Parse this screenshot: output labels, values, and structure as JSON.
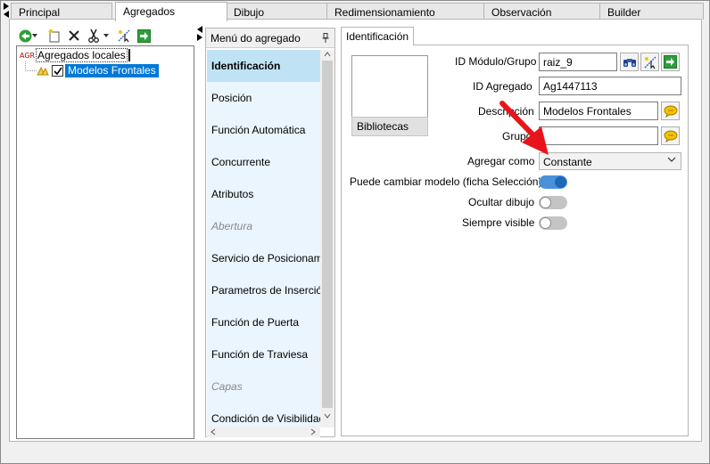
{
  "tabs": [
    {
      "label": "Principal",
      "active": false
    },
    {
      "label": "Agregados",
      "active": true
    },
    {
      "label": "Dibujo",
      "active": false
    },
    {
      "label": "Redimensionamiento",
      "active": false
    },
    {
      "label": "Observación",
      "active": false
    },
    {
      "label": "Builder",
      "active": false
    }
  ],
  "tree": {
    "root_badge": "AGR",
    "root_label": "Agregados locales",
    "child_label": "Modelos Frontales",
    "child_checked": true
  },
  "menu": {
    "header": "Menú do agregado",
    "items": [
      {
        "label": "Identificación",
        "state": "selected"
      },
      {
        "label": "Posición",
        "state": "normal"
      },
      {
        "label": "Función Automática",
        "state": "normal"
      },
      {
        "label": "Concurrente",
        "state": "normal"
      },
      {
        "label": "Atributos",
        "state": "normal"
      },
      {
        "label": "Abertura",
        "state": "disabled"
      },
      {
        "label": "Servicio de Posicionamiento",
        "state": "normal"
      },
      {
        "label": "Parametros de Inserción",
        "state": "normal"
      },
      {
        "label": "Función de Puerta",
        "state": "normal"
      },
      {
        "label": "Función de Traviesa",
        "state": "normal"
      },
      {
        "label": "Capas",
        "state": "disabled"
      },
      {
        "label": "Condición de Visibilidad",
        "state": "normal"
      }
    ]
  },
  "identificacion": {
    "tab_label": "Identificación",
    "bibliotecas_label": "Bibliotecas",
    "id_modulo_label": "ID Módulo/Grupo",
    "id_modulo_value": "raiz_9",
    "id_agregado_label": "ID Agregado",
    "id_agregado_value": "Ag1447113",
    "descripcion_label": "Descripción",
    "descripcion_value": "Modelos Frontales",
    "grupo_label": "Grupo",
    "grupo_value": "",
    "agregar_como_label": "Agregar como",
    "agregar_como_value": "Constante",
    "puede_cambiar_label": "Puede cambiar modelo (ficha Selección)",
    "puede_cambiar_on": true,
    "ocultar_dibujo_label": "Ocultar dibujo",
    "ocultar_dibujo_on": false,
    "siempre_visible_label": "Siempre visible",
    "siempre_visible_on": false
  },
  "colors": {
    "selection": "#0078d7",
    "menu_bg": "#eaf5fd",
    "menu_selected": "#bfe3f5",
    "toggle_on": "#4a90d9",
    "annotation_arrow": "#e8141c"
  }
}
